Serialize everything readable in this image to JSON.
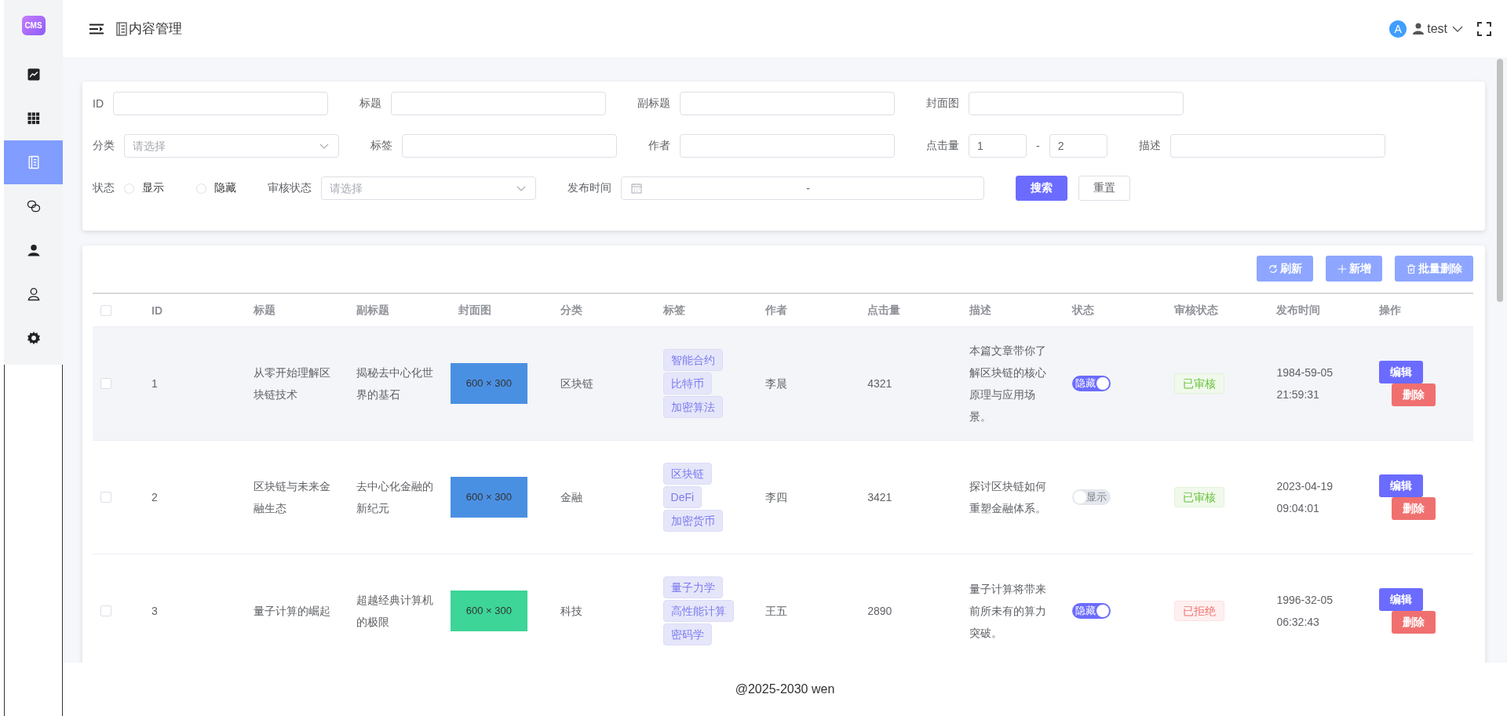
{
  "sidebar": {
    "logo": "CMS",
    "items": [
      {
        "selected": false
      },
      {
        "selected": false
      },
      {
        "selected": true
      },
      {
        "selected": false
      },
      {
        "selected": false
      },
      {
        "selected": false
      },
      {
        "selected": false
      }
    ]
  },
  "header": {
    "title": "内容管理",
    "user": {
      "avatar": "A",
      "name": "test"
    }
  },
  "filters": {
    "rows": [
      {
        "fields": [
          {
            "kind": "text",
            "label": "ID"
          },
          {
            "kind": "text",
            "label": "标题"
          },
          {
            "kind": "text",
            "label": "副标题"
          },
          {
            "kind": "text",
            "label": "封面图"
          }
        ]
      },
      {
        "fields": [
          {
            "kind": "select",
            "label": "分类",
            "placeholder": "请选择"
          },
          {
            "kind": "text",
            "label": "标签"
          },
          {
            "kind": "text",
            "label": "作者"
          },
          {
            "kind": "range",
            "label": "点击量",
            "from": "1",
            "separator": "-",
            "to": "2"
          },
          {
            "kind": "text",
            "label": "描述"
          }
        ]
      },
      {
        "fields": [
          {
            "kind": "radio",
            "label": "状态",
            "options": [
              {
                "label": "显示",
                "selected": false
              },
              {
                "label": "隐藏",
                "selected": false
              }
            ]
          },
          {
            "kind": "select",
            "label": "审核状态",
            "placeholder": "请选择"
          },
          {
            "kind": "date",
            "label": "发布时间",
            "separator": "-"
          }
        ]
      }
    ],
    "buttons": [
      {
        "label": "搜索",
        "kind": "primary"
      },
      {
        "label": "重置",
        "kind": "default"
      }
    ]
  },
  "table": {
    "toolbar": [
      {
        "label": "刷新"
      },
      {
        "label": "新增"
      },
      {
        "label": "批量删除"
      }
    ],
    "select_all": {
      "checked": false
    },
    "columns": [
      "ID",
      "标题",
      "副标题",
      "封面图",
      "分类",
      "标签",
      "作者",
      "点击量",
      "描述",
      "状态",
      "审核状态",
      "发布时间",
      "操作"
    ],
    "rows": [
      {
        "checked": false,
        "highlighted": true,
        "id": "1",
        "title": "从零开始理解区块链技术",
        "subtitle": "揭秘去中心化世界的基石",
        "cover": {
          "text": "600 × 300",
          "color": "#4a90e2"
        },
        "category": "区块链",
        "tags": [
          "智能合约",
          "比特币",
          "加密算法"
        ],
        "author": "李晨",
        "views": "4321",
        "description": "本篇文章带你了解区块链的核心原理与应用场景。",
        "status": {
          "label": "隐藏",
          "on": true
        },
        "review": {
          "label": "已审核",
          "kind": "approved"
        },
        "published": "1984-59-05 21:59:31",
        "actions": [
          {
            "label": "编辑",
            "kind": "edit"
          },
          {
            "label": "删除",
            "kind": "delete"
          }
        ]
      },
      {
        "checked": false,
        "highlighted": false,
        "id": "2",
        "title": "区块链与未来金融生态",
        "subtitle": "去中心化金融的新纪元",
        "cover": {
          "text": "600 × 300",
          "color": "#4a90e2"
        },
        "category": "金融",
        "tags": [
          "区块链",
          "DeFi",
          "加密货币"
        ],
        "author": "李四",
        "views": "3421",
        "description": "探讨区块链如何重塑金融体系。",
        "status": {
          "label": "显示",
          "on": false
        },
        "review": {
          "label": "已审核",
          "kind": "approved"
        },
        "published": "2023-04-19 09:04:01",
        "actions": [
          {
            "label": "编辑",
            "kind": "edit"
          },
          {
            "label": "删除",
            "kind": "delete"
          }
        ]
      },
      {
        "checked": false,
        "highlighted": false,
        "id": "3",
        "title": "量子计算的崛起",
        "subtitle": "超越经典计算机的极限",
        "cover": {
          "text": "600 × 300",
          "color": "#3dd598"
        },
        "category": "科技",
        "tags": [
          "量子力学",
          "高性能计算",
          "密码学"
        ],
        "author": "王五",
        "views": "2890",
        "description": "量子计算将带来前所未有的算力突破。",
        "status": {
          "label": "隐藏",
          "on": true
        },
        "review": {
          "label": "已拒绝",
          "kind": "rejected"
        },
        "published": "1996-32-05 06:32:43",
        "actions": [
          {
            "label": "编辑",
            "kind": "edit"
          },
          {
            "label": "删除",
            "kind": "delete"
          }
        ]
      }
    ]
  },
  "footer": "@2025-2030 wen"
}
